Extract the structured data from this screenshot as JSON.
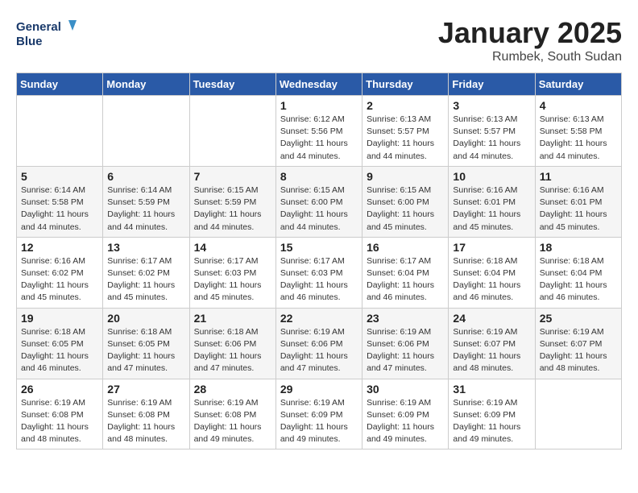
{
  "logo": {
    "line1": "General",
    "line2": "Blue"
  },
  "title": "January 2025",
  "location": "Rumbek, South Sudan",
  "days_of_week": [
    "Sunday",
    "Monday",
    "Tuesday",
    "Wednesday",
    "Thursday",
    "Friday",
    "Saturday"
  ],
  "weeks": [
    [
      {
        "day": "",
        "sunrise": "",
        "sunset": "",
        "daylight": ""
      },
      {
        "day": "",
        "sunrise": "",
        "sunset": "",
        "daylight": ""
      },
      {
        "day": "",
        "sunrise": "",
        "sunset": "",
        "daylight": ""
      },
      {
        "day": "1",
        "sunrise": "Sunrise: 6:12 AM",
        "sunset": "Sunset: 5:56 PM",
        "daylight": "Daylight: 11 hours and 44 minutes."
      },
      {
        "day": "2",
        "sunrise": "Sunrise: 6:13 AM",
        "sunset": "Sunset: 5:57 PM",
        "daylight": "Daylight: 11 hours and 44 minutes."
      },
      {
        "day": "3",
        "sunrise": "Sunrise: 6:13 AM",
        "sunset": "Sunset: 5:57 PM",
        "daylight": "Daylight: 11 hours and 44 minutes."
      },
      {
        "day": "4",
        "sunrise": "Sunrise: 6:13 AM",
        "sunset": "Sunset: 5:58 PM",
        "daylight": "Daylight: 11 hours and 44 minutes."
      }
    ],
    [
      {
        "day": "5",
        "sunrise": "Sunrise: 6:14 AM",
        "sunset": "Sunset: 5:58 PM",
        "daylight": "Daylight: 11 hours and 44 minutes."
      },
      {
        "day": "6",
        "sunrise": "Sunrise: 6:14 AM",
        "sunset": "Sunset: 5:59 PM",
        "daylight": "Daylight: 11 hours and 44 minutes."
      },
      {
        "day": "7",
        "sunrise": "Sunrise: 6:15 AM",
        "sunset": "Sunset: 5:59 PM",
        "daylight": "Daylight: 11 hours and 44 minutes."
      },
      {
        "day": "8",
        "sunrise": "Sunrise: 6:15 AM",
        "sunset": "Sunset: 6:00 PM",
        "daylight": "Daylight: 11 hours and 44 minutes."
      },
      {
        "day": "9",
        "sunrise": "Sunrise: 6:15 AM",
        "sunset": "Sunset: 6:00 PM",
        "daylight": "Daylight: 11 hours and 45 minutes."
      },
      {
        "day": "10",
        "sunrise": "Sunrise: 6:16 AM",
        "sunset": "Sunset: 6:01 PM",
        "daylight": "Daylight: 11 hours and 45 minutes."
      },
      {
        "day": "11",
        "sunrise": "Sunrise: 6:16 AM",
        "sunset": "Sunset: 6:01 PM",
        "daylight": "Daylight: 11 hours and 45 minutes."
      }
    ],
    [
      {
        "day": "12",
        "sunrise": "Sunrise: 6:16 AM",
        "sunset": "Sunset: 6:02 PM",
        "daylight": "Daylight: 11 hours and 45 minutes."
      },
      {
        "day": "13",
        "sunrise": "Sunrise: 6:17 AM",
        "sunset": "Sunset: 6:02 PM",
        "daylight": "Daylight: 11 hours and 45 minutes."
      },
      {
        "day": "14",
        "sunrise": "Sunrise: 6:17 AM",
        "sunset": "Sunset: 6:03 PM",
        "daylight": "Daylight: 11 hours and 45 minutes."
      },
      {
        "day": "15",
        "sunrise": "Sunrise: 6:17 AM",
        "sunset": "Sunset: 6:03 PM",
        "daylight": "Daylight: 11 hours and 46 minutes."
      },
      {
        "day": "16",
        "sunrise": "Sunrise: 6:17 AM",
        "sunset": "Sunset: 6:04 PM",
        "daylight": "Daylight: 11 hours and 46 minutes."
      },
      {
        "day": "17",
        "sunrise": "Sunrise: 6:18 AM",
        "sunset": "Sunset: 6:04 PM",
        "daylight": "Daylight: 11 hours and 46 minutes."
      },
      {
        "day": "18",
        "sunrise": "Sunrise: 6:18 AM",
        "sunset": "Sunset: 6:04 PM",
        "daylight": "Daylight: 11 hours and 46 minutes."
      }
    ],
    [
      {
        "day": "19",
        "sunrise": "Sunrise: 6:18 AM",
        "sunset": "Sunset: 6:05 PM",
        "daylight": "Daylight: 11 hours and 46 minutes."
      },
      {
        "day": "20",
        "sunrise": "Sunrise: 6:18 AM",
        "sunset": "Sunset: 6:05 PM",
        "daylight": "Daylight: 11 hours and 47 minutes."
      },
      {
        "day": "21",
        "sunrise": "Sunrise: 6:18 AM",
        "sunset": "Sunset: 6:06 PM",
        "daylight": "Daylight: 11 hours and 47 minutes."
      },
      {
        "day": "22",
        "sunrise": "Sunrise: 6:19 AM",
        "sunset": "Sunset: 6:06 PM",
        "daylight": "Daylight: 11 hours and 47 minutes."
      },
      {
        "day": "23",
        "sunrise": "Sunrise: 6:19 AM",
        "sunset": "Sunset: 6:06 PM",
        "daylight": "Daylight: 11 hours and 47 minutes."
      },
      {
        "day": "24",
        "sunrise": "Sunrise: 6:19 AM",
        "sunset": "Sunset: 6:07 PM",
        "daylight": "Daylight: 11 hours and 48 minutes."
      },
      {
        "day": "25",
        "sunrise": "Sunrise: 6:19 AM",
        "sunset": "Sunset: 6:07 PM",
        "daylight": "Daylight: 11 hours and 48 minutes."
      }
    ],
    [
      {
        "day": "26",
        "sunrise": "Sunrise: 6:19 AM",
        "sunset": "Sunset: 6:08 PM",
        "daylight": "Daylight: 11 hours and 48 minutes."
      },
      {
        "day": "27",
        "sunrise": "Sunrise: 6:19 AM",
        "sunset": "Sunset: 6:08 PM",
        "daylight": "Daylight: 11 hours and 48 minutes."
      },
      {
        "day": "28",
        "sunrise": "Sunrise: 6:19 AM",
        "sunset": "Sunset: 6:08 PM",
        "daylight": "Daylight: 11 hours and 49 minutes."
      },
      {
        "day": "29",
        "sunrise": "Sunrise: 6:19 AM",
        "sunset": "Sunset: 6:09 PM",
        "daylight": "Daylight: 11 hours and 49 minutes."
      },
      {
        "day": "30",
        "sunrise": "Sunrise: 6:19 AM",
        "sunset": "Sunset: 6:09 PM",
        "daylight": "Daylight: 11 hours and 49 minutes."
      },
      {
        "day": "31",
        "sunrise": "Sunrise: 6:19 AM",
        "sunset": "Sunset: 6:09 PM",
        "daylight": "Daylight: 11 hours and 49 minutes."
      },
      {
        "day": "",
        "sunrise": "",
        "sunset": "",
        "daylight": ""
      }
    ]
  ]
}
